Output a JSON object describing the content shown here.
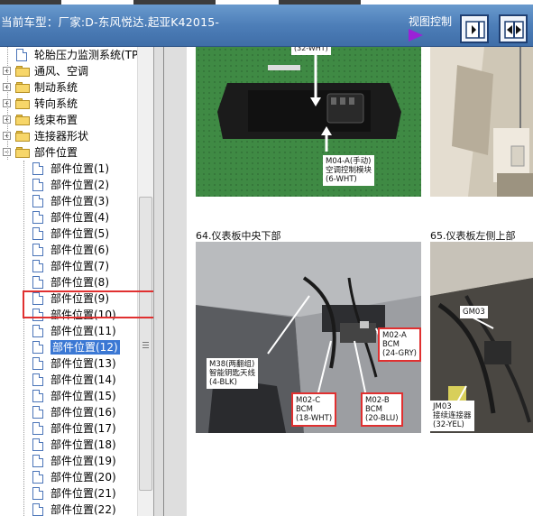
{
  "header": {
    "vehicle_label": "当前车型：厂家:D-东风悦达.起亚K42015-",
    "view_control_label": "视图控制",
    "icons": [
      "play-icon",
      "panel-right-icon",
      "panel-split-icon"
    ]
  },
  "tree": {
    "items": [
      {
        "label": "轮胎压力监测系统(TPM",
        "type": "doc"
      },
      {
        "label": "通风、空调",
        "type": "folder",
        "expander": "+"
      },
      {
        "label": "制动系统",
        "type": "folder",
        "expander": "+"
      },
      {
        "label": "转向系统",
        "type": "folder",
        "expander": "+"
      },
      {
        "label": "线束布置",
        "type": "folder",
        "expander": "+"
      },
      {
        "label": "连接器形状",
        "type": "folder",
        "expander": "+"
      },
      {
        "label": "部件位置",
        "type": "folder",
        "expander": "−"
      },
      {
        "label": "部件位置(1)",
        "type": "doc"
      },
      {
        "label": "部件位置(2)",
        "type": "doc"
      },
      {
        "label": "部件位置(3)",
        "type": "doc"
      },
      {
        "label": "部件位置(4)",
        "type": "doc"
      },
      {
        "label": "部件位置(5)",
        "type": "doc"
      },
      {
        "label": "部件位置(6)",
        "type": "doc"
      },
      {
        "label": "部件位置(7)",
        "type": "doc"
      },
      {
        "label": "部件位置(8)",
        "type": "doc"
      },
      {
        "label": "部件位置(9)",
        "type": "doc"
      },
      {
        "label": "部件位置(10)",
        "type": "doc"
      },
      {
        "label": "部件位置(11)",
        "type": "doc"
      },
      {
        "label": "部件位置(12)",
        "type": "doc",
        "selected": true
      },
      {
        "label": "部件位置(13)",
        "type": "doc"
      },
      {
        "label": "部件位置(14)",
        "type": "doc"
      },
      {
        "label": "部件位置(15)",
        "type": "doc"
      },
      {
        "label": "部件位置(16)",
        "type": "doc"
      },
      {
        "label": "部件位置(17)",
        "type": "doc"
      },
      {
        "label": "部件位置(18)",
        "type": "doc"
      },
      {
        "label": "部件位置(19)",
        "type": "doc"
      },
      {
        "label": "部件位置(20)",
        "type": "doc"
      },
      {
        "label": "部件位置(21)",
        "type": "doc"
      },
      {
        "label": "部件位置(22)",
        "type": "doc"
      }
    ]
  },
  "document": {
    "top_left": {
      "callout_top": "(32-WHT)",
      "callout": [
        "M04-A(手动)",
        "空调控制模块",
        "(6-WHT)"
      ]
    },
    "caption_64": "64.仪表板中央下部",
    "caption_65": "65.仪表板左侧上部",
    "photo_64_callouts": {
      "m38": [
        "M38(两翻组)",
        "智能钥匙天线",
        "(4-BLK)"
      ],
      "m02a": [
        "M02-A",
        "BCM",
        "(24-GRY)"
      ],
      "m02c": [
        "M02-C",
        "BCM",
        "(18-WHT)"
      ],
      "m02b": [
        "M02-B",
        "BCM",
        "(20-BLU)"
      ]
    },
    "photo_65_callouts": {
      "gm03": "GM03",
      "jm03": [
        "JM03",
        "接续连接器",
        "(32-YEL)"
      ]
    }
  },
  "colors": {
    "header_bg": "#4d7eb8",
    "selection_bg": "#3b78d4",
    "highlight_red": "#e03030",
    "play_icon": "#9a22d6"
  }
}
